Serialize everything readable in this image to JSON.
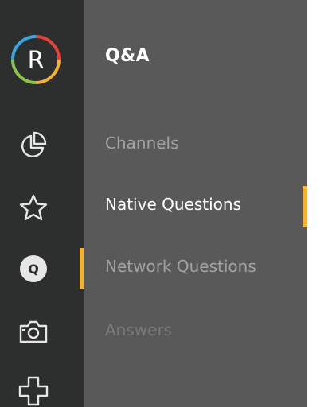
{
  "brand": {
    "logo_letter": "R",
    "ring_colors": [
      "#e8403a",
      "#f2b233",
      "#8bc34a",
      "#3aa6dd"
    ]
  },
  "rail": {
    "items": [
      {
        "icon": "pie-chart-icon"
      },
      {
        "icon": "star-icon"
      },
      {
        "icon": "q-badge-icon",
        "label": "Q"
      },
      {
        "icon": "camera-icon"
      },
      {
        "icon": "plus-icon"
      }
    ]
  },
  "panel": {
    "title": "Q&A",
    "items": [
      {
        "label": "Channels",
        "state": "normal"
      },
      {
        "label": "Native Questions",
        "state": "active"
      },
      {
        "label": "Network Questions",
        "state": "normal"
      },
      {
        "label": "Answers",
        "state": "disabled"
      }
    ]
  },
  "colors": {
    "accent": "#f2b233",
    "rail_bg": "#2c2f2e",
    "panel_bg": "#595959"
  }
}
